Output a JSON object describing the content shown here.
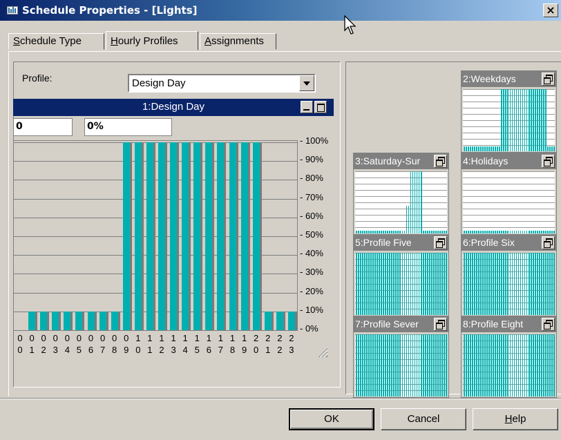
{
  "window": {
    "title": "Schedule Properties - [Lights]",
    "close_label": "×"
  },
  "tabs": [
    {
      "prefix": "",
      "key": "S",
      "rest": "chedule Type",
      "active": false
    },
    {
      "prefix": "",
      "key": "H",
      "rest": "ourly Profiles",
      "active": true
    },
    {
      "prefix": "",
      "key": "A",
      "rest": "ssignments",
      "active": false
    }
  ],
  "profile": {
    "label": "Profile:",
    "selected": "Design Day"
  },
  "chart_window": {
    "title": "1:Design Day",
    "hour_value": "0",
    "percent_value": "0%"
  },
  "chart_data": {
    "type": "bar",
    "title": "1:Design Day",
    "categories": [
      "00",
      "01",
      "02",
      "03",
      "04",
      "05",
      "06",
      "07",
      "08",
      "09",
      "10",
      "11",
      "12",
      "13",
      "14",
      "15",
      "16",
      "17",
      "18",
      "19",
      "20",
      "21",
      "22",
      "23"
    ],
    "values": [
      0,
      10,
      10,
      10,
      10,
      10,
      10,
      10,
      10,
      100,
      100,
      100,
      100,
      100,
      100,
      100,
      100,
      100,
      100,
      100,
      100,
      10,
      10,
      10
    ],
    "ylim": [
      0,
      100
    ],
    "ytick_labels": [
      "100%",
      "90%",
      "80%",
      "70%",
      "60%",
      "50%",
      "40%",
      "30%",
      "20%",
      "10%",
      "0%"
    ],
    "grid": true
  },
  "thumbnails": [
    {
      "title": "2:Weekdays",
      "values": [
        8,
        8,
        8,
        8,
        8,
        8,
        8,
        8,
        8,
        8,
        8,
        8,
        8,
        8,
        8,
        8,
        8,
        8,
        100,
        100,
        100,
        100,
        100,
        100,
        100,
        100,
        100,
        100,
        100,
        100,
        100,
        100,
        100,
        100,
        100,
        100,
        100,
        100,
        100,
        100,
        8,
        8,
        8,
        8
      ]
    },
    {
      "title": "3:Saturday-Sur",
      "values": [
        5,
        5,
        5,
        5,
        5,
        5,
        5,
        5,
        5,
        5,
        5,
        5,
        5,
        5,
        5,
        5,
        5,
        5,
        5,
        5,
        5,
        5,
        5,
        5,
        45,
        45,
        100,
        100,
        100,
        100,
        100,
        100,
        5,
        5,
        5,
        5,
        5,
        5,
        5,
        5,
        5,
        5,
        5,
        5
      ]
    },
    {
      "title": "4:Holidays",
      "values": [
        5,
        5,
        5,
        5,
        5,
        5,
        5,
        5,
        5,
        5,
        5,
        5,
        5,
        5,
        5,
        5,
        5,
        5,
        5,
        5,
        5,
        5,
        5,
        5,
        5,
        5,
        5,
        5,
        5,
        5,
        5,
        5,
        5,
        5,
        5,
        5,
        5,
        5,
        5,
        5,
        5,
        5,
        5,
        5
      ]
    },
    {
      "title": "5:Profile Five",
      "values": [
        100,
        100,
        100,
        100,
        100,
        100,
        100,
        100,
        100,
        100,
        100,
        100,
        100,
        100,
        100,
        100,
        100,
        100,
        100,
        100,
        100,
        100,
        100,
        100,
        100,
        100,
        100,
        100,
        100,
        100,
        100,
        100,
        100,
        100,
        100,
        100,
        100,
        100,
        100,
        100,
        100,
        100,
        100,
        100
      ]
    },
    {
      "title": "6:Profile Six",
      "values": [
        100,
        100,
        100,
        100,
        100,
        100,
        100,
        100,
        100,
        100,
        100,
        100,
        100,
        100,
        100,
        100,
        100,
        100,
        100,
        100,
        100,
        100,
        100,
        100,
        100,
        100,
        100,
        100,
        100,
        100,
        100,
        100,
        100,
        100,
        100,
        100,
        100,
        100,
        100,
        100,
        100,
        100,
        100,
        100
      ]
    },
    {
      "title": "7:Profile Sever",
      "values": [
        100,
        100,
        100,
        100,
        100,
        100,
        100,
        100,
        100,
        100,
        100,
        100,
        100,
        100,
        100,
        100,
        100,
        100,
        100,
        100,
        100,
        100,
        100,
        100,
        100,
        100,
        100,
        100,
        100,
        100,
        100,
        100,
        100,
        100,
        100,
        100,
        100,
        100,
        100,
        100,
        100,
        100,
        100,
        100
      ]
    },
    {
      "title": "8:Profile Eight",
      "values": [
        100,
        100,
        100,
        100,
        100,
        100,
        100,
        100,
        100,
        100,
        100,
        100,
        100,
        100,
        100,
        100,
        100,
        100,
        100,
        100,
        100,
        100,
        100,
        100,
        100,
        100,
        100,
        100,
        100,
        100,
        100,
        100,
        100,
        100,
        100,
        100,
        100,
        100,
        100,
        100,
        100,
        100,
        100,
        100
      ]
    }
  ],
  "buttons": {
    "ok": "OK",
    "cancel": "Cancel",
    "help_key": "H",
    "help_rest": "elp"
  },
  "colors": {
    "bar": "#00b0b0",
    "title_active": "#0a246a",
    "title_inactive": "#808080",
    "face": "#d4d0c8"
  }
}
